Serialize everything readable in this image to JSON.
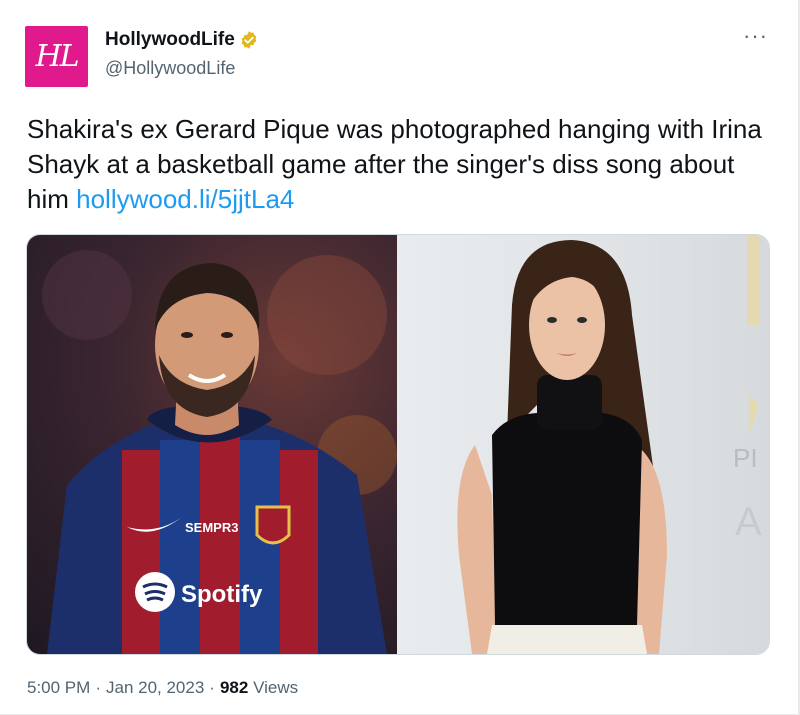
{
  "author": {
    "avatar_text": "HL",
    "display_name": "HollywoodLife",
    "handle": "@HollywoodLife",
    "verified_color": "#e2b719"
  },
  "more_label": "···",
  "tweet": {
    "text": "Shakira's ex Gerard Pique was photographed hanging with Irina Shayk at a basketball game after the singer's diss song about him ",
    "link": "hollywood.li/5jjtLa4"
  },
  "media": {
    "left_photo": {
      "jersey_text_1": "SEMPR3",
      "jersey_text_2": "Spotify"
    },
    "right_photo": {
      "backdrop_text_1": "PI",
      "backdrop_text_2": "A"
    }
  },
  "footer": {
    "time": "5:00 PM",
    "sep1": "·",
    "date": "Jan 20, 2023",
    "sep2": "·",
    "views_count": "982",
    "views_label": "Views"
  },
  "colors": {
    "link": "#1d9bf0",
    "avatar_bg": "#e0198c",
    "secondary_text": "#536471"
  }
}
